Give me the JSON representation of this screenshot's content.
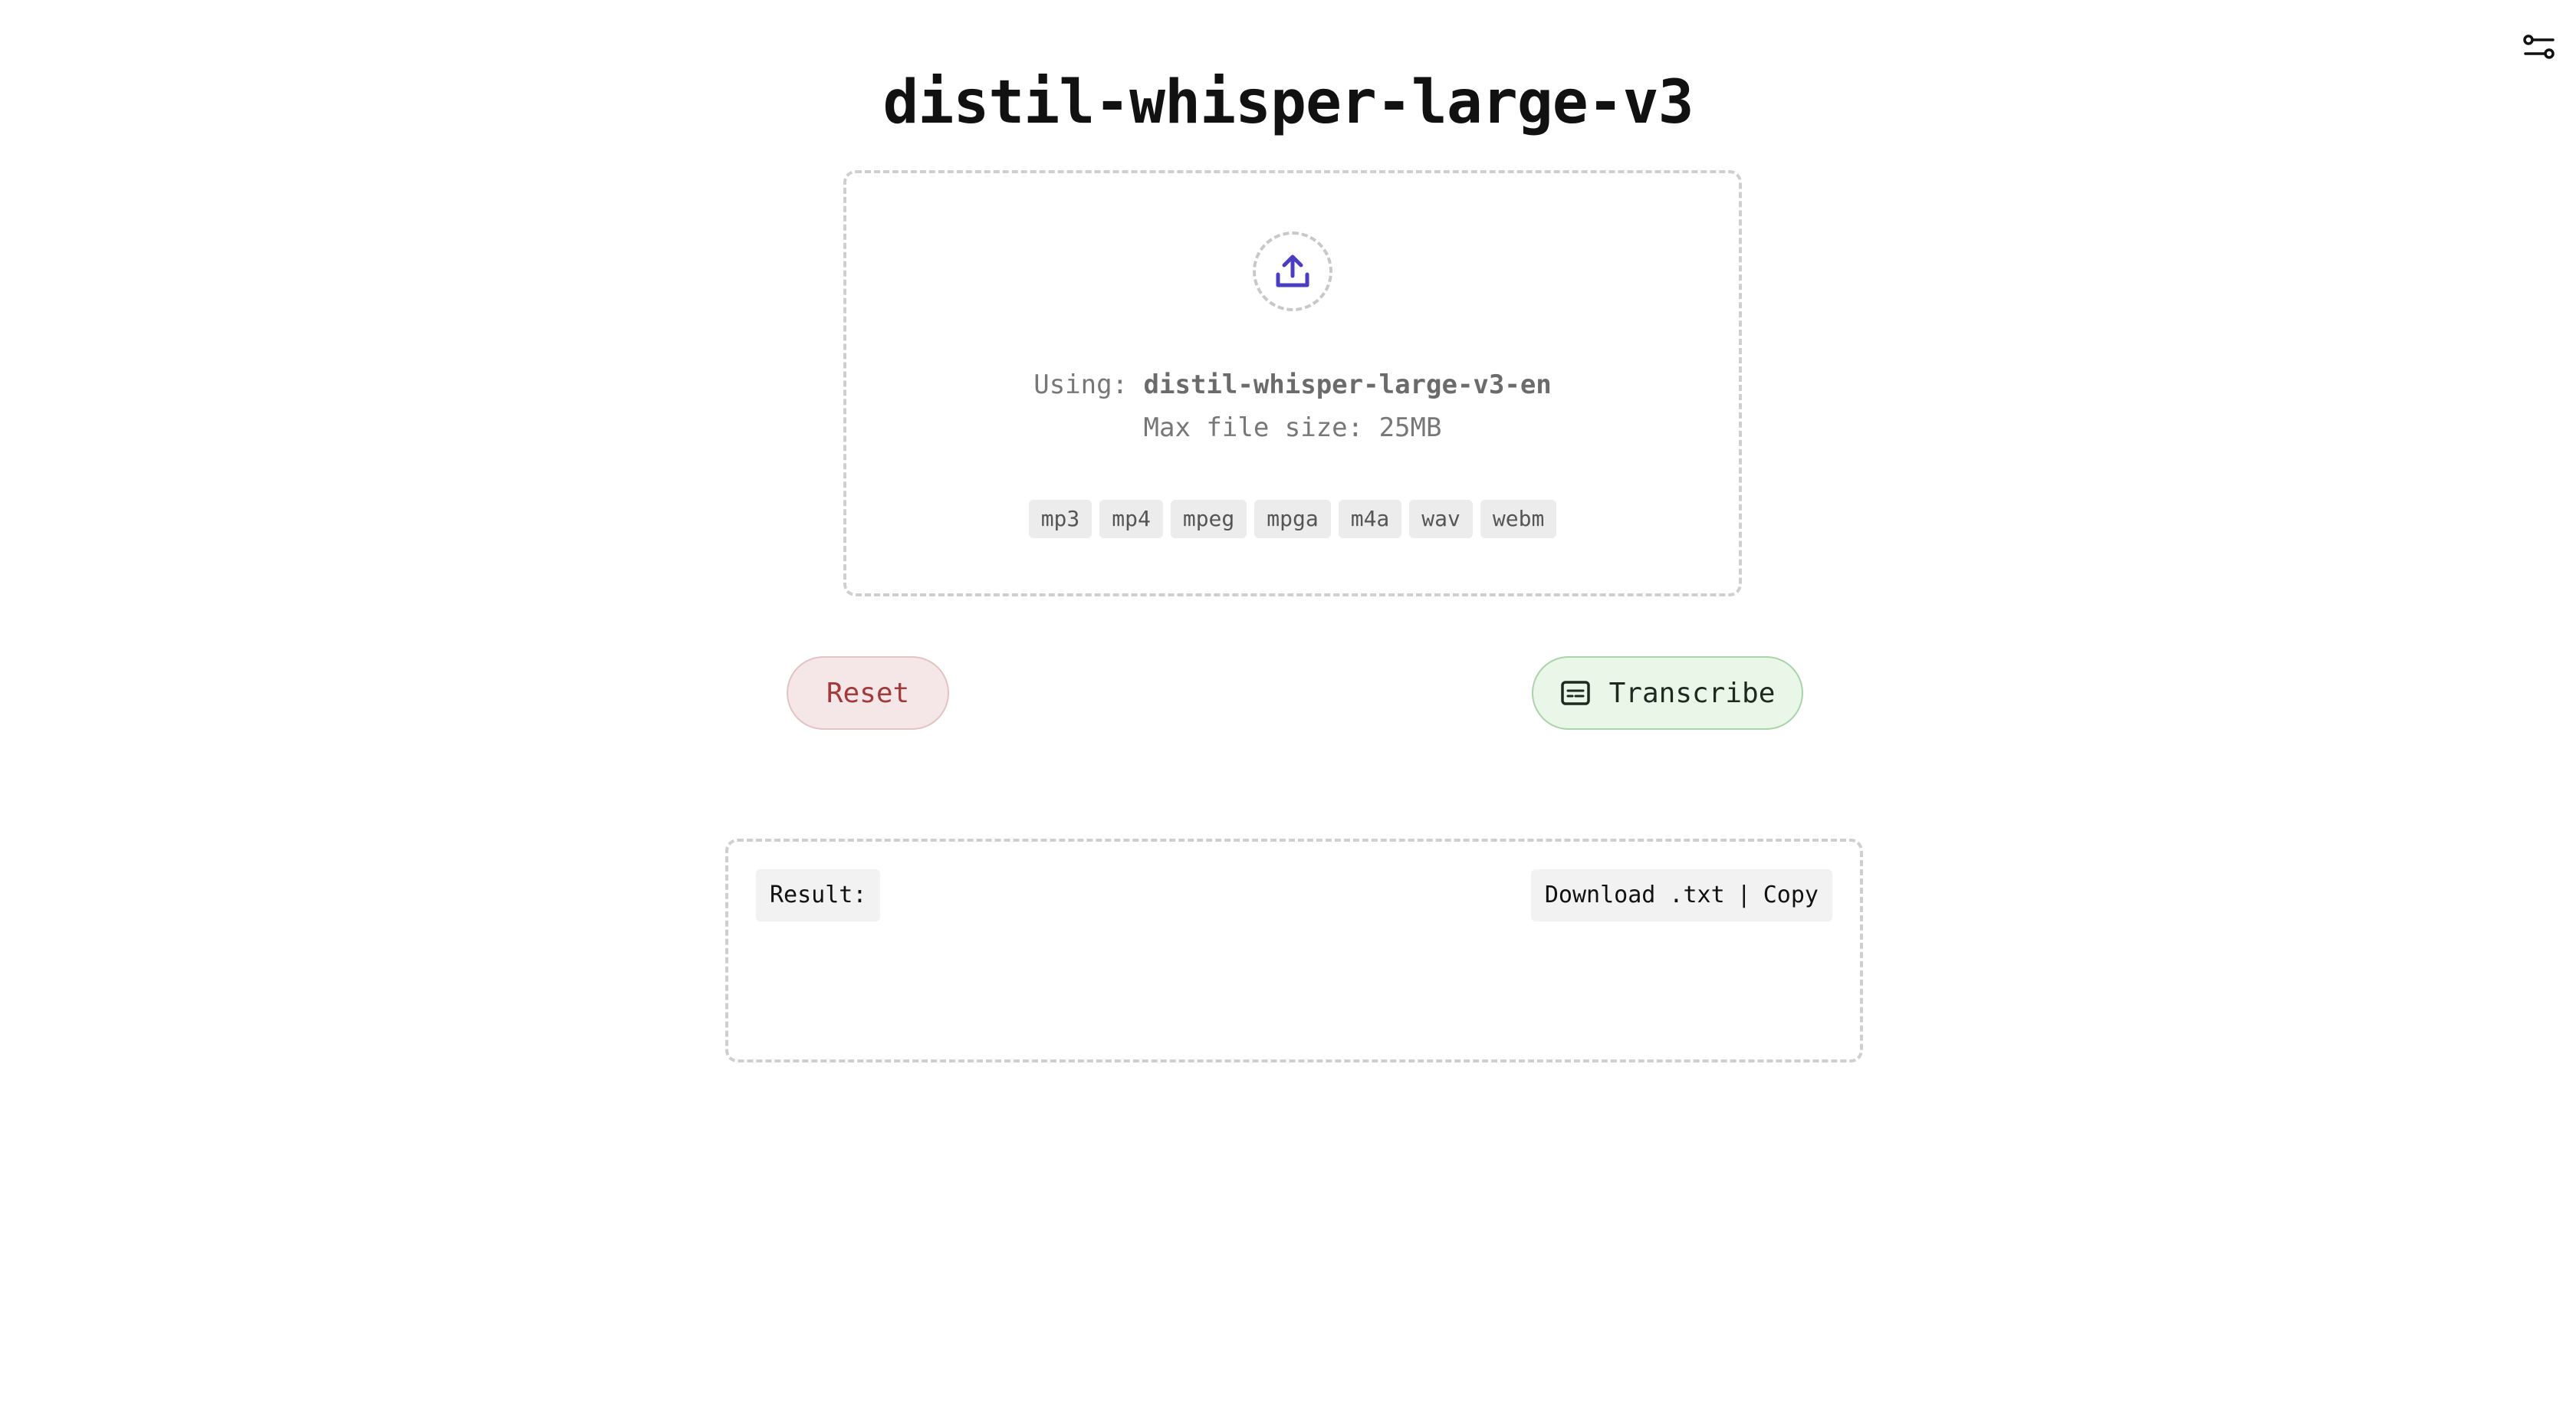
{
  "header": {
    "title": "distil-whisper-large-v3",
    "settings_icon": "settings-sliders-icon"
  },
  "dropzone": {
    "upload_icon": "upload-icon",
    "upload_icon_color": "#4a3dc4",
    "using_label": "Using:",
    "model_name": "distil-whisper-large-v3-en",
    "max_size": "Max file size: 25MB",
    "formats": [
      "mp3",
      "mp4",
      "mpeg",
      "mpga",
      "m4a",
      "wav",
      "webm"
    ]
  },
  "actions": {
    "reset_label": "Reset",
    "transcribe_label": "Transcribe",
    "transcribe_icon": "subtitles-icon"
  },
  "result": {
    "label": "Result:",
    "download_label": "Download .txt",
    "separator": "|",
    "copy_label": "Copy",
    "text": ""
  },
  "colors": {
    "reset_bg": "#f5e7e7",
    "reset_text": "#a33a3a",
    "transcribe_bg": "#e9f6e8",
    "transcribe_border": "#a9d4a9"
  }
}
